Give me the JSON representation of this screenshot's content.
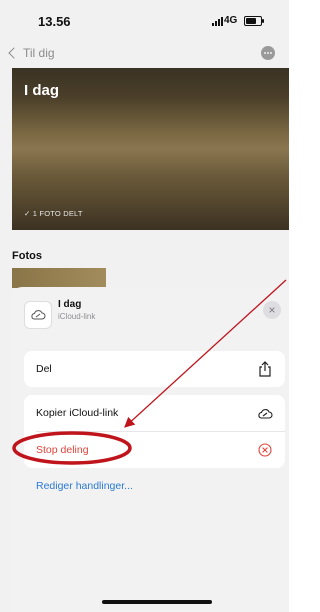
{
  "status_bar": {
    "time": "13.56",
    "network": "4G"
  },
  "nav": {
    "back_label": "Til dig"
  },
  "hero": {
    "title": "I dag",
    "photo_count": "1 FOTO DELT"
  },
  "fotos": {
    "title": "Fotos"
  },
  "sheet": {
    "album_title": "I dag",
    "album_subtitle": "iCloud-link",
    "actions": [
      {
        "label": "Del",
        "icon": "share-icon"
      },
      {
        "label": "Kopier iCloud-link",
        "icon": "cloud-link-icon"
      },
      {
        "label": "Stop deling",
        "icon": "stop-icon"
      }
    ],
    "edit_actions": "Rediger handlinger..."
  },
  "colors": {
    "destructive": "#e0443a",
    "link": "#2a7ad6",
    "annotation": "#c0141c"
  }
}
